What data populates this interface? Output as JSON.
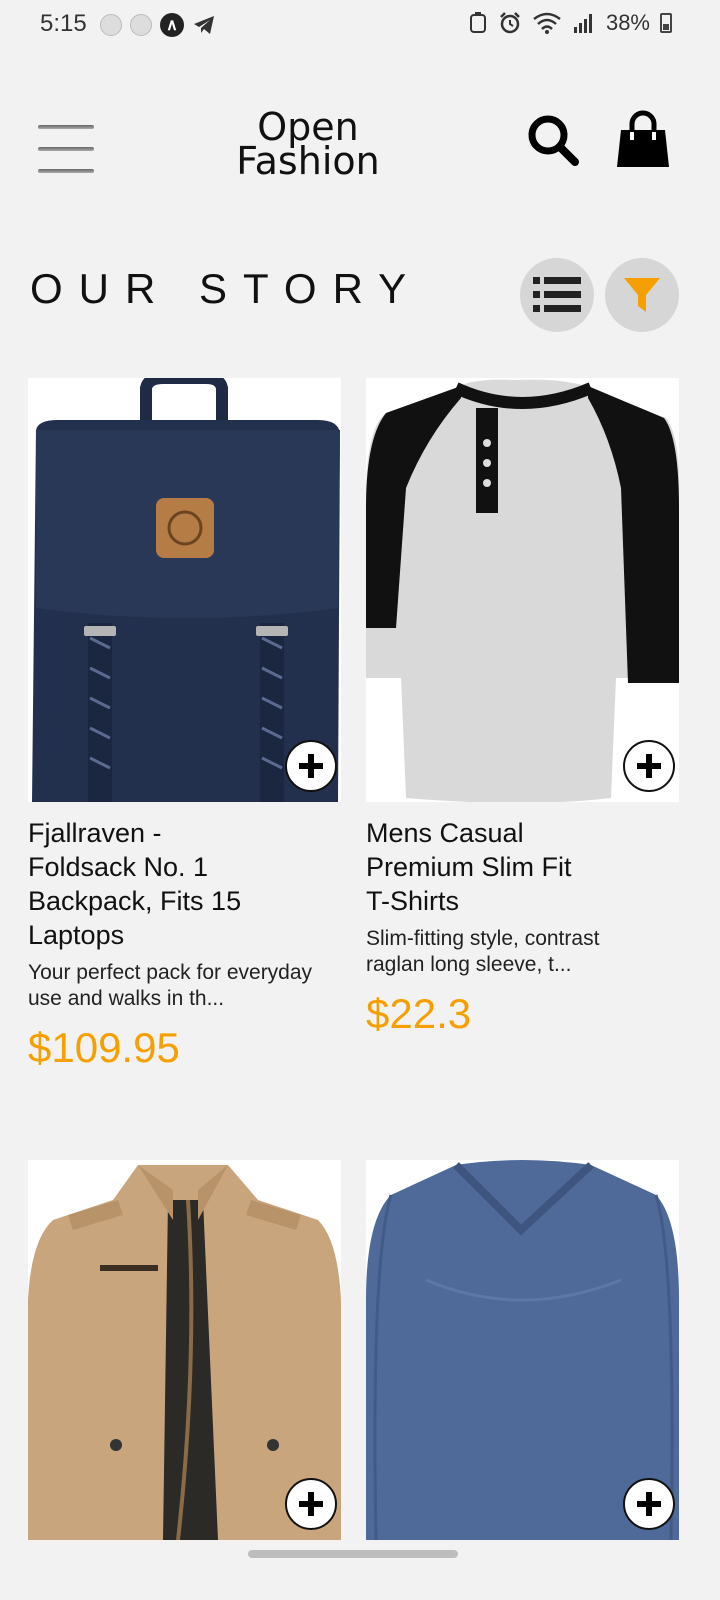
{
  "status_bar": {
    "time": "5:15",
    "battery": "38%"
  },
  "header": {
    "logo_line1": "Open",
    "logo_line2": "Fashion"
  },
  "section": {
    "title": "OUR STORY"
  },
  "colors": {
    "accent": "#f5a000",
    "background": "#f2f2f2",
    "button_bg": "#d6d6d6"
  },
  "products": [
    {
      "name": "Fjallraven - Foldsack No. 1 Backpack, Fits 15 Laptops",
      "description": "Your perfect pack for everyday use and walks in th...",
      "price": "$109.95",
      "image_icon": "backpack-image"
    },
    {
      "name": "Mens Casual Premium Slim Fit T-Shirts",
      "description": "Slim-fitting style, contrast raglan long sleeve, t...",
      "price": "$22.3",
      "image_icon": "raglan-tshirt-image"
    },
    {
      "image_icon": "jacket-image"
    },
    {
      "image_icon": "vneck-shirt-image"
    }
  ]
}
